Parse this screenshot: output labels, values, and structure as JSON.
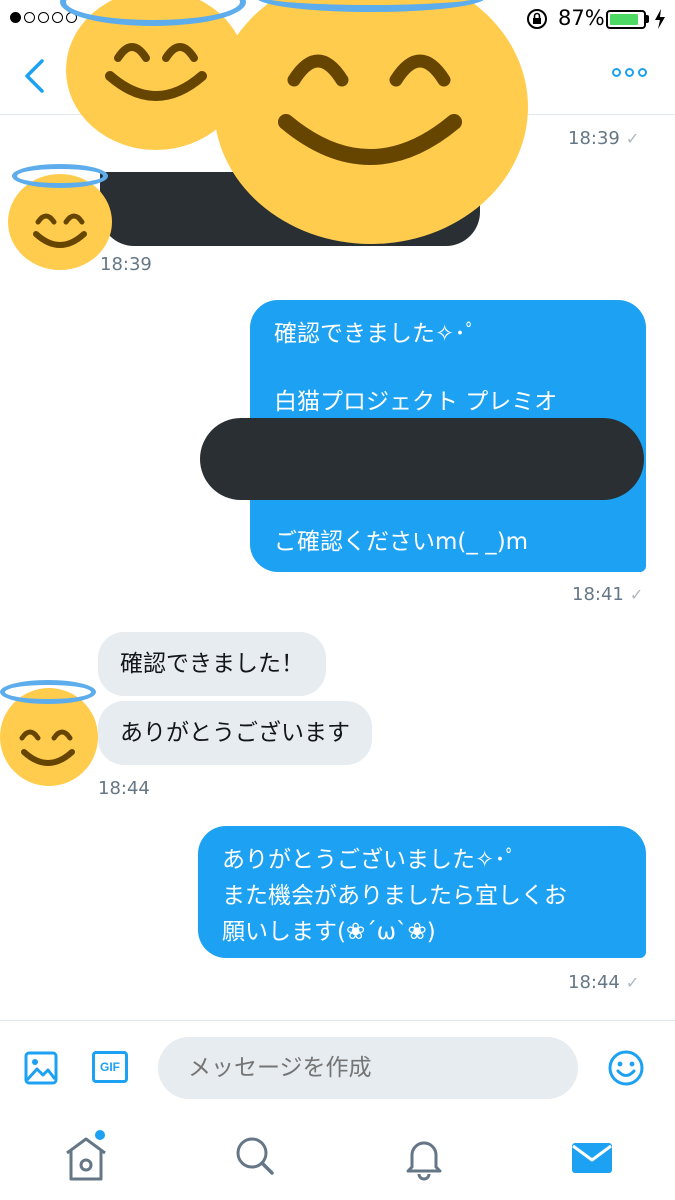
{
  "status_bar": {
    "signal_bars_filled": 1,
    "signal_bars_total": 5,
    "battery_percent": "87%",
    "battery_level": 0.87,
    "icons": [
      "rotation-lock-icon",
      "battery-icon",
      "charging-bolt-icon"
    ]
  },
  "nav": {
    "back_icon": "chevron-left-icon",
    "more_icon": "more-dots-icon",
    "accent_color": "#1da1f2"
  },
  "messages": [
    {
      "direction": "out",
      "timestamp": "18:39",
      "redacted": true
    },
    {
      "direction": "in",
      "timestamp": "18:39",
      "redacted": true
    },
    {
      "direction": "out",
      "lines": [
        "確認できました✧･ﾟ",
        "白猫プロジェクト プレミオ",
        "ご確認くださいm(_ _)m"
      ],
      "redacted_middle": true,
      "timestamp": "18:41"
    },
    {
      "direction": "in",
      "bubbles": [
        "確認できました！",
        "ありがとうございます"
      ],
      "timestamp": "18:44"
    },
    {
      "direction": "out",
      "lines": [
        "ありがとうございました✧･ﾟ",
        "また機会がありましたら宜しくお",
        "願いします(❀´ω`❀)"
      ],
      "timestamp": "18:44"
    }
  ],
  "composer": {
    "placeholder": "メッセージを作成",
    "gif_label": "GIF",
    "icons": [
      "image-icon",
      "gif-icon",
      "emoji-icon"
    ]
  },
  "tabbar": {
    "items": [
      {
        "icon": "home-icon",
        "has_notification_dot": true
      },
      {
        "icon": "search-icon"
      },
      {
        "icon": "notifications-icon"
      },
      {
        "icon": "messages-icon",
        "active": true
      }
    ]
  },
  "colors": {
    "outgoing_bubble": "#1da1f2",
    "incoming_bubble": "#e6ecf0",
    "redaction": "#292f33",
    "emoji_face": "#ffcc4d",
    "halo": "#5dadec"
  }
}
